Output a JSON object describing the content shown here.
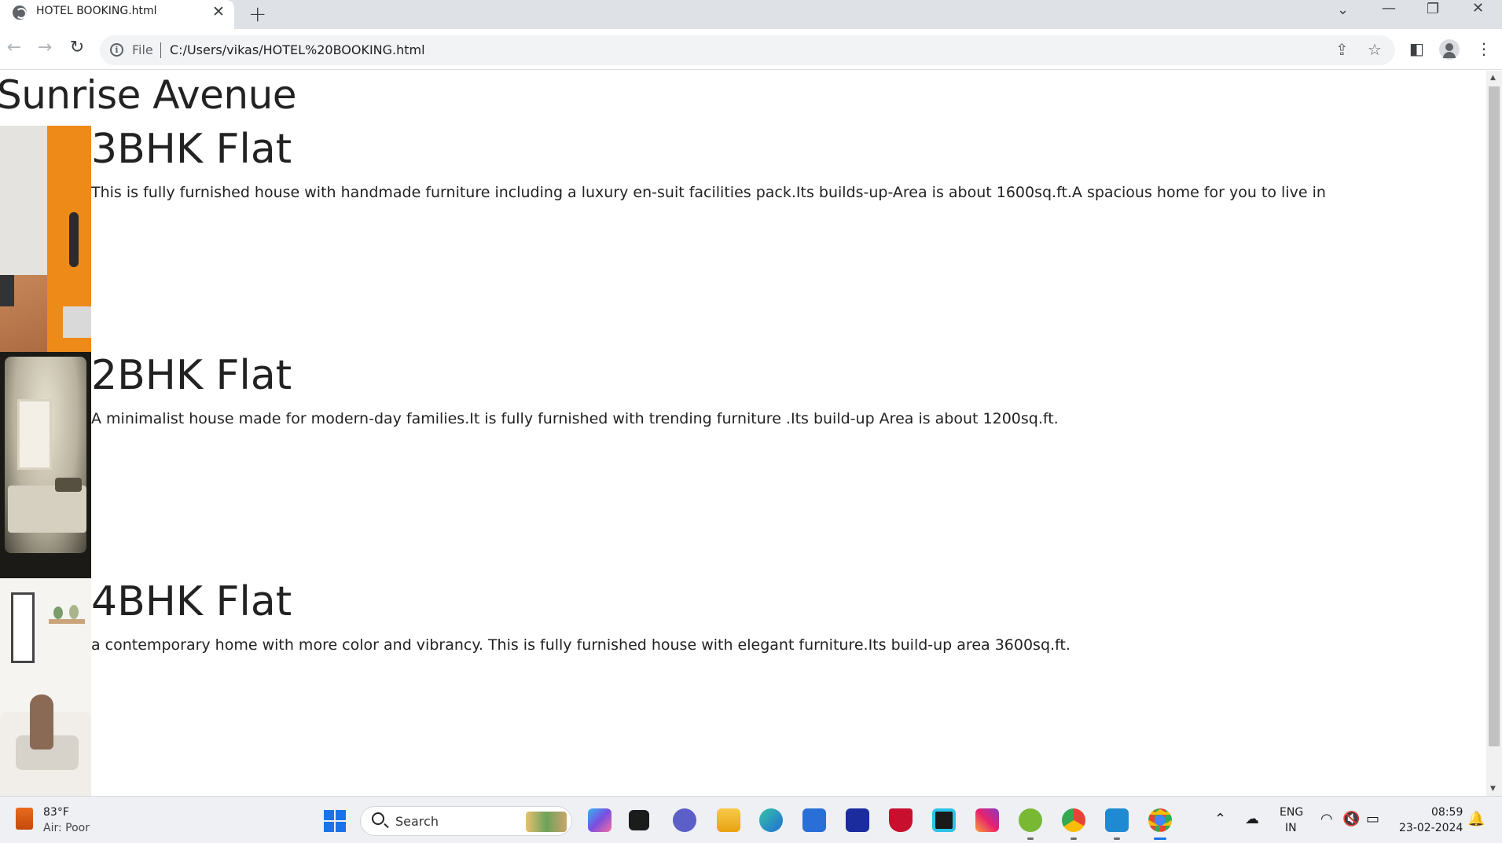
{
  "browser": {
    "tab_title": "HOTEL BOOKING.html",
    "tab_close": "✕",
    "new_tab": "+",
    "address_scheme_label": "File",
    "url": "C:/Users/vikas/HOTEL%20BOOKING.html"
  },
  "page": {
    "site_title": "Sunrise Avenue",
    "listings": [
      {
        "title": "3BHK Flat",
        "description": "This is fully furnished house with handmade furniture including a luxury en-suit facilities pack.Its builds-up-Area is about 1600sq.ft.A spacious home for you to live in"
      },
      {
        "title": "2BHK Flat",
        "description": "A minimalist house made for modern-day families.It is fully furnished with trending furniture .Its build-up Area is about 1200sq.ft."
      },
      {
        "title": "4BHK Flat",
        "description": "a contemporary home with more color and vibrancy. This is fully furnished house with elegant furniture.Its build-up area 3600sq.ft."
      }
    ]
  },
  "taskbar": {
    "weather_temp": "83°F",
    "weather_status": "Air: Poor",
    "search_label": "Search",
    "language_top": "ENG",
    "language_bottom": "IN",
    "time": "08:59",
    "date": "23-02-2024",
    "icons": [
      "weather-icon",
      "start-icon",
      "search-icon",
      "clipchamp-icon",
      "file-explorer-black-icon",
      "teams-icon",
      "folder-icon",
      "edge-icon",
      "store-icon",
      "l-app-icon",
      "mcafee-icon",
      "alexa-icon",
      "instagram-icon",
      "utorrent-icon",
      "chrome-alt-icon",
      "vscode-icon",
      "chrome-icon"
    ]
  },
  "colors": {
    "accent_orange": "#ee8a17",
    "chrome_tabbar": "#dee1e6",
    "taskbar_bg": "#eef0f4"
  }
}
